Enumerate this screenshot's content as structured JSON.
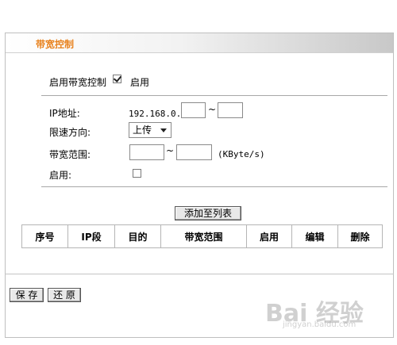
{
  "panel": {
    "title": "带宽控制"
  },
  "enable_row": {
    "label": "启用带宽控制",
    "checked": true,
    "value_label": "启用"
  },
  "form": {
    "ip_label": "IP地址:",
    "ip_prefix": "192.168.0.",
    "ip_start": "",
    "ip_sep": "~",
    "ip_end": "",
    "direction_label": "限速方向:",
    "direction_value": "上传",
    "range_label": "带宽范围:",
    "range_min": "",
    "range_sep": "~",
    "range_max": "",
    "range_unit": "(KByte/s)",
    "enable_label": "启用:",
    "enable_checked": false
  },
  "add_button": "添加至列表",
  "table": {
    "headers": [
      "序号",
      "IP段",
      "目的",
      "带宽范围",
      "启用",
      "编辑",
      "删除"
    ]
  },
  "footer": {
    "save": "保 存",
    "restore": "还 原"
  },
  "watermark": {
    "text": "Bai 经验",
    "sub": "jingyan.baidu.com"
  }
}
